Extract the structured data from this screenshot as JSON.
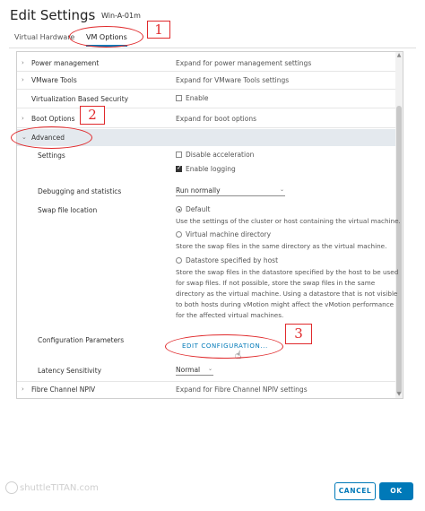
{
  "dialog": {
    "title": "Edit Settings",
    "vm_name": "Win-A-01m"
  },
  "tabs": [
    {
      "label": "Virtual Hardware"
    },
    {
      "label": "VM Options"
    }
  ],
  "rows": {
    "power": {
      "label": "Power management",
      "value": "Expand for power management settings"
    },
    "tools": {
      "label": "VMware Tools",
      "value": "Expand for VMware Tools settings"
    },
    "vbs": {
      "label": "Virtualization Based Security",
      "checkbox_label": "Enable"
    },
    "boot": {
      "label": "Boot Options",
      "value": "Expand for boot options"
    },
    "advanced": {
      "label": "Advanced"
    },
    "settings": {
      "label": "Settings",
      "disable_accel": "Disable acceleration",
      "enable_logging": "Enable logging"
    },
    "debug": {
      "label": "Debugging and statistics",
      "value": "Run normally"
    },
    "swap": {
      "label": "Swap file location",
      "default_label": "Default",
      "default_desc": "Use the settings of the cluster or host containing the virtual machine.",
      "vmdir_label": "Virtual machine directory",
      "vmdir_desc": "Store the swap files in the same directory as the virtual machine.",
      "ds_label": "Datastore specified by host",
      "ds_desc_1": "Store the swap files in the datastore specified by the host to be used",
      "ds_desc_2": "for swap files. If not possible, store the swap files in the same",
      "ds_desc_3": "directory as the virtual machine. Using a datastore that is not visible",
      "ds_desc_4": "to both hosts during vMotion might affect the vMotion performance",
      "ds_desc_5": "for the affected virtual machines."
    },
    "config": {
      "label": "Configuration Parameters",
      "link": "EDIT CONFIGURATION..."
    },
    "latency": {
      "label": "Latency Sensitivity",
      "value": "Normal"
    },
    "fc": {
      "label": "Fibre Channel NPIV",
      "value": "Expand for Fibre Channel NPIV settings"
    }
  },
  "annotations": [
    "1",
    "2",
    "3"
  ],
  "watermark": "shuttleTITAN.com",
  "buttons": {
    "cancel": "CANCEL",
    "ok": "OK"
  },
  "colors": {
    "accent": "#0079b8",
    "annotation": "#e0292b",
    "advanced_bg": "#e4e9ee"
  },
  "state": {
    "active_tab": "VM Options",
    "vbs_enabled": false,
    "disable_acceleration": false,
    "enable_logging": true,
    "swap_selected": "Default"
  }
}
